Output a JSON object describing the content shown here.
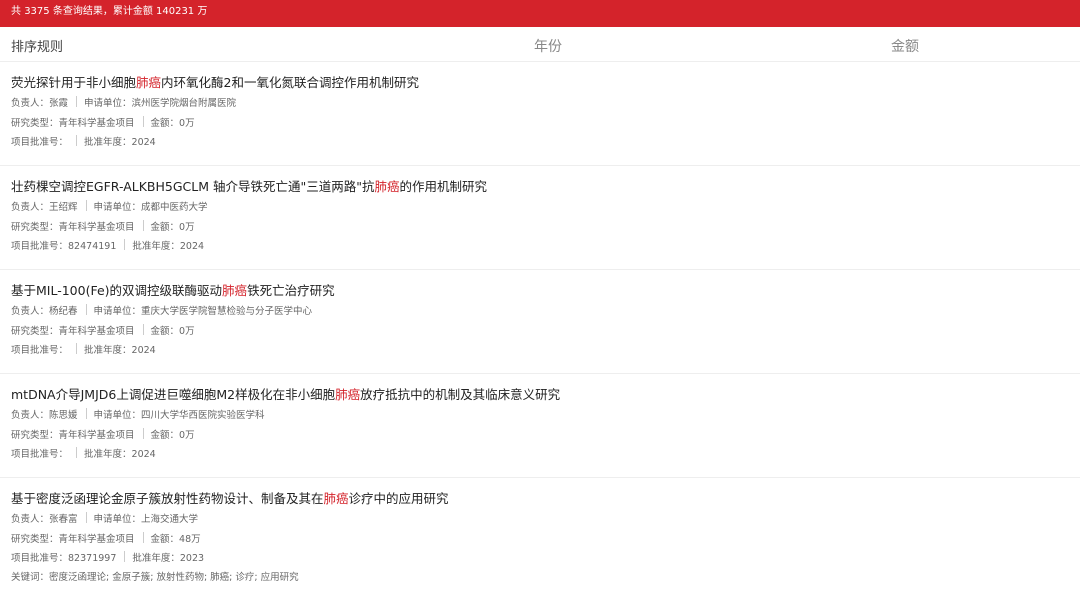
{
  "summary": {
    "prefix": "共 ",
    "count": "3375",
    "mid": " 条查询结果，累计金额 ",
    "total": "140231",
    "suffix": " 万"
  },
  "sortbar": {
    "label": "排序规则",
    "year": "年份",
    "amount": "金额"
  },
  "labels": {
    "person": "负责人：",
    "unit": "申请单位：",
    "type": "研究类型：",
    "amount": "金额：",
    "approval_no": "项目批准号：",
    "approval_year": "批准年度：",
    "keywords": "关键词："
  },
  "results": [
    {
      "title_before": "荧光探针用于非小细胞",
      "title_highlight": "肺癌",
      "title_after": "内环氧化酶2和一氧化氮联合调控作用机制研究",
      "person": "张霞",
      "unit": "滨州医学院烟台附属医院",
      "type": "青年科学基金项目",
      "amount": "0万",
      "approval_no": "",
      "approval_year": "2024"
    },
    {
      "title_before": "壮药棵空调控EGFR-ALKBH5GCLM 轴介导铁死亡通\"三道两路\"抗",
      "title_highlight": "肺癌",
      "title_after": "的作用机制研究",
      "person": "王绍辉",
      "unit": "成都中医药大学",
      "type": "青年科学基金项目",
      "amount": "0万",
      "approval_no": "82474191",
      "approval_year": "2024"
    },
    {
      "title_before": "基于MIL-100(Fe)的双调控级联酶驱动",
      "title_highlight": "肺癌",
      "title_after": "铁死亡治疗研究",
      "person": "杨纪春",
      "unit": "重庆大学医学院智慧检验与分子医学中心",
      "type": "青年科学基金项目",
      "amount": "0万",
      "approval_no": "",
      "approval_year": "2024"
    },
    {
      "title_before": "mtDNA介导JMJD6上调促进巨噬细胞M2样极化在非小细胞",
      "title_highlight": "肺癌",
      "title_after": "放疗抵抗中的机制及其临床意义研究",
      "person": "陈思媛",
      "unit": "四川大学华西医院实验医学科",
      "type": "青年科学基金项目",
      "amount": "0万",
      "approval_no": "",
      "approval_year": "2024"
    },
    {
      "title_before": "基于密度泛函理论金原子簇放射性药物设计、制备及其在",
      "title_highlight": "肺癌",
      "title_after": "诊疗中的应用研究",
      "person": "张春富",
      "unit": "上海交通大学",
      "type": "青年科学基金项目",
      "amount": "48万",
      "approval_no": "82371997",
      "approval_year": "2023",
      "keywords": "密度泛函理论; 金原子簇; 放射性药物; 肺癌; 诊疗; 应用研究"
    }
  ]
}
